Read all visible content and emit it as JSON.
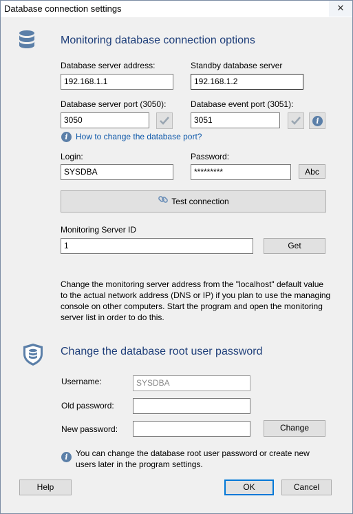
{
  "window": {
    "title": "Database connection settings",
    "close_glyph": "✕"
  },
  "monitoring": {
    "heading": "Monitoring database connection options",
    "server_address": {
      "label": "Database server address:",
      "value": "192.168.1.1"
    },
    "standby_server": {
      "label": "Standby database server",
      "value": "192.168.1.2"
    },
    "server_port": {
      "label": "Database server port (3050):",
      "value": "3050"
    },
    "event_port": {
      "label": "Database event port (3051):",
      "value": "3051"
    },
    "port_help_link": "How to change the database port?",
    "login": {
      "label": "Login:",
      "value": "SYSDBA"
    },
    "password": {
      "label": "Password:",
      "value": "*********",
      "show_button": "Abc"
    },
    "test_button": "Test connection",
    "server_id": {
      "label": "Monitoring Server ID",
      "value": "1",
      "get_button": "Get"
    },
    "note": "Change the monitoring server address from the \"localhost\" default value to the actual network address (DNS or IP) if you plan to use the managing console on other computers. Start the program and open the monitoring server list in order to do this."
  },
  "root_password": {
    "heading": "Change the database root user password",
    "username": {
      "label": "Username:",
      "value": "SYSDBA"
    },
    "old_password": {
      "label": "Old password:",
      "value": ""
    },
    "new_password": {
      "label": "New password:",
      "value": ""
    },
    "change_button": "Change",
    "info_text": "You can change the database root user password or create new users later in the program settings."
  },
  "footer": {
    "help": "Help",
    "ok": "OK",
    "cancel": "Cancel"
  },
  "colors": {
    "accent": "#0078d7",
    "heading": "#1f3f7a",
    "icon": "#5b7fa8"
  }
}
